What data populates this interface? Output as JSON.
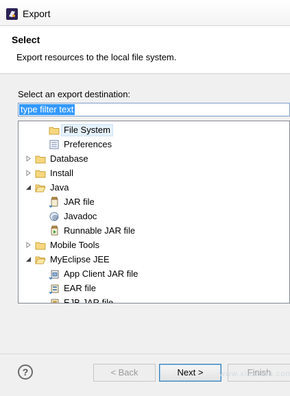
{
  "window": {
    "title": "Export",
    "icon": "eclipse-icon"
  },
  "header": {
    "title": "Select",
    "description": "Export resources to the local file system."
  },
  "destination_label": "Select an export destination:",
  "filter": {
    "value": "type filter text"
  },
  "tree": {
    "items": [
      {
        "label": "File System",
        "icon": "folder-icon",
        "selected": true
      },
      {
        "label": "Preferences",
        "icon": "preferences-icon"
      },
      {
        "label": "Database",
        "icon": "folder-icon",
        "state": "collapsed"
      },
      {
        "label": "Install",
        "icon": "folder-icon",
        "state": "collapsed"
      },
      {
        "label": "Java",
        "icon": "folder-icon",
        "state": "expanded"
      },
      {
        "label": "JAR file",
        "icon": "jar-icon"
      },
      {
        "label": "Javadoc",
        "icon": "javadoc-icon"
      },
      {
        "label": "Runnable JAR file",
        "icon": "runnable-jar-icon"
      },
      {
        "label": "Mobile Tools",
        "icon": "folder-icon",
        "state": "collapsed"
      },
      {
        "label": "MyEclipse JEE",
        "icon": "folder-icon",
        "state": "expanded"
      },
      {
        "label": "App Client JAR file",
        "icon": "app-client-jar-icon"
      },
      {
        "label": "EAR file",
        "icon": "ear-icon"
      },
      {
        "label": "EJB JAR file",
        "icon": "ejb-jar-icon"
      }
    ]
  },
  "buttons": {
    "help": "?",
    "back": "< Back",
    "next": "Next >",
    "finish": "Finish"
  },
  "watermark": "www.xiazaiba.com"
}
